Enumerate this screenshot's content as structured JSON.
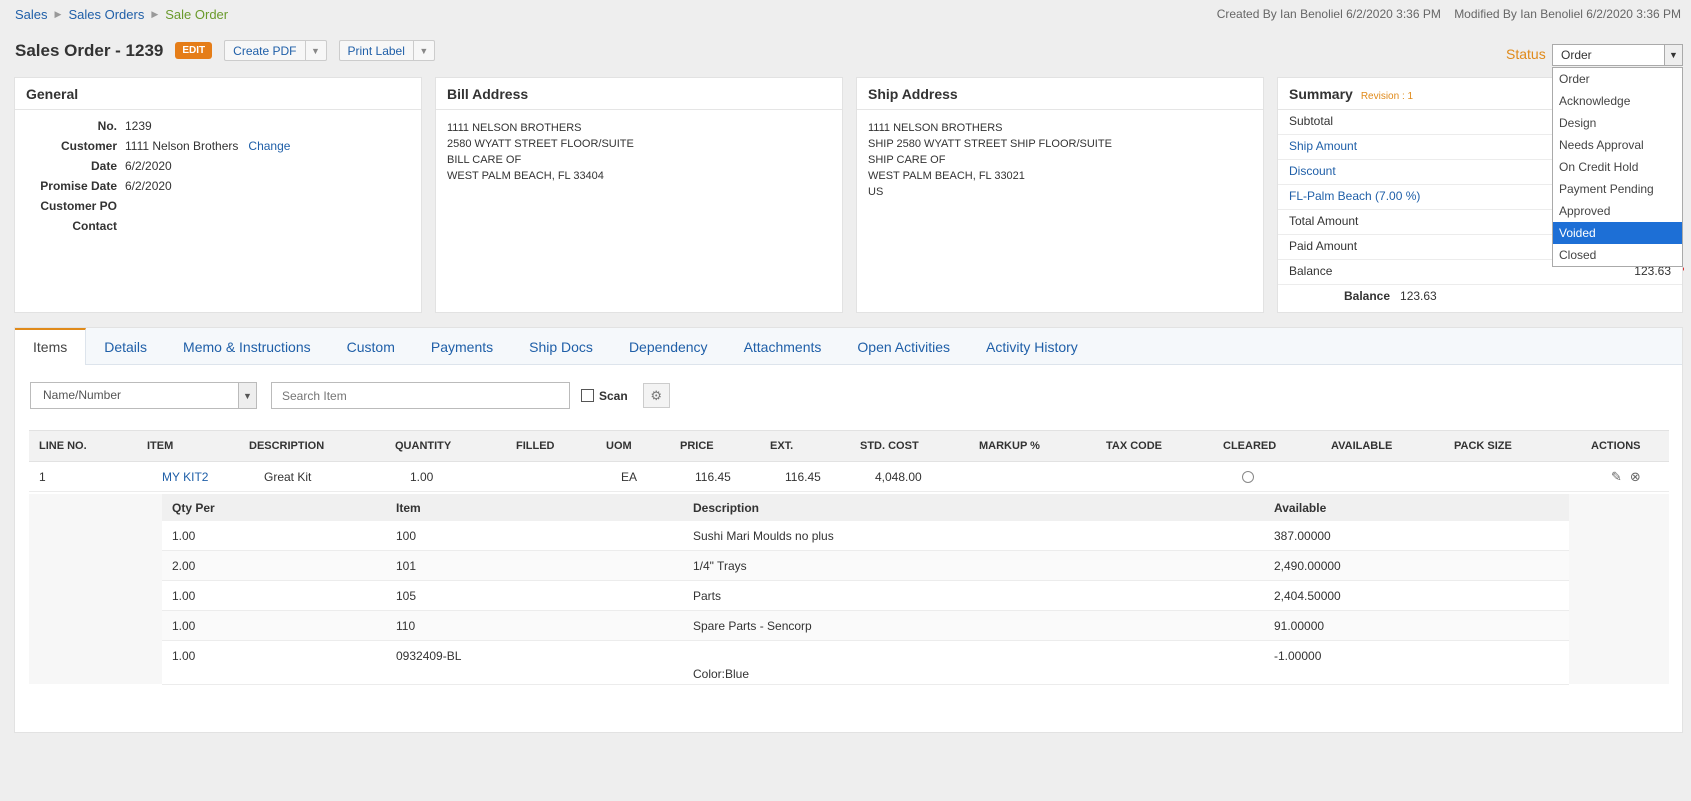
{
  "breadcrumb": [
    "Sales",
    "Sales Orders",
    "Sale Order"
  ],
  "meta": {
    "created": "Created By Ian Benoliel 6/2/2020 3:36 PM",
    "modified": "Modified By Ian Benoliel 6/2/2020 3:36 PM"
  },
  "header": {
    "title": "Sales Order - 1239",
    "edit": "EDIT",
    "create_pdf": "Create PDF",
    "print_label": "Print Label"
  },
  "status": {
    "label": "Status",
    "value": "Order",
    "options": [
      "Order",
      "Acknowledge",
      "Design",
      "Needs Approval",
      "On Credit Hold",
      "Payment Pending",
      "Approved",
      "Voided",
      "Closed"
    ],
    "highlighted": "Voided"
  },
  "general": {
    "title": "General",
    "fields": [
      {
        "label": "No.",
        "value": "1239"
      },
      {
        "label": "Customer",
        "value": "1111 Nelson Brothers",
        "action": "Change"
      },
      {
        "label": "Date",
        "value": "6/2/2020"
      },
      {
        "label": "Promise Date",
        "value": "6/2/2020"
      },
      {
        "label": "Customer PO",
        "value": ""
      },
      {
        "label": "Contact",
        "value": ""
      }
    ]
  },
  "bill_address": {
    "title": "Bill Address",
    "lines": [
      "1111 NELSON BROTHERS",
      "2580 WYATT STREET FLOOR/SUITE",
      "BILL CARE OF",
      "WEST PALM BEACH, FL 33404"
    ]
  },
  "ship_address": {
    "title": "Ship Address",
    "lines": [
      "1111 NELSON BROTHERS",
      "SHIP 2580 WYATT STREET SHIP FLOOR/SUITE",
      "SHIP CARE OF",
      "WEST PALM BEACH, FL 33021",
      "US"
    ]
  },
  "summary": {
    "title": "Summary",
    "revision": "Revision : 1",
    "rows": [
      {
        "label": "Subtotal",
        "value": ""
      },
      {
        "label": "Ship Amount",
        "value": ""
      },
      {
        "label": "Discount",
        "value": ""
      },
      {
        "label": "FL-Palm Beach (7.00 %)",
        "value": ""
      },
      {
        "label": "Total Amount",
        "value": ""
      },
      {
        "label": "Paid Amount",
        "value": ""
      },
      {
        "label": "Balance",
        "value": "123.63"
      }
    ],
    "balance_label": "Balance",
    "balance_value": "123.63"
  },
  "tabs": [
    "Items",
    "Details",
    "Memo & Instructions",
    "Custom",
    "Payments",
    "Ship Docs",
    "Dependency",
    "Attachments",
    "Open Activities",
    "Activity History"
  ],
  "toolbar": {
    "select": "Name/Number",
    "search_placeholder": "Search Item",
    "scan": "Scan"
  },
  "items": {
    "columns": [
      "LINE NO.",
      "ITEM",
      "DESCRIPTION",
      "QUANTITY",
      "FILLED",
      "UOM",
      "PRICE",
      "EXT.",
      "STD. COST",
      "MARKUP %",
      "TAX CODE",
      "CLEARED",
      "AVAILABLE",
      "PACK SIZE",
      "ACTIONS"
    ],
    "row": {
      "line": "1",
      "item": "MY KIT2",
      "description": "Great Kit",
      "quantity": "1.00",
      "filled": "",
      "uom": "EA",
      "price": "116.45",
      "ext": "116.45",
      "std_cost": "4,048.00"
    }
  },
  "kit": {
    "columns": [
      "Qty Per",
      "Item",
      "Description",
      "Available"
    ],
    "rows": [
      {
        "qty": "1.00",
        "item": "100",
        "description": "Sushi Mari Moulds no plus",
        "available": "387.00000"
      },
      {
        "qty": "2.00",
        "item": "101",
        "description": "1/4\" Trays",
        "available": "2,490.00000"
      },
      {
        "qty": "1.00",
        "item": "105",
        "description": "Parts",
        "available": "2,404.50000"
      },
      {
        "qty": "1.00",
        "item": "110",
        "description": "Spare Parts - Sencorp",
        "available": "91.00000"
      },
      {
        "qty": "1.00",
        "item": "0932409-BL",
        "description": "Color:Blue",
        "available": "-1.00000"
      }
    ]
  }
}
